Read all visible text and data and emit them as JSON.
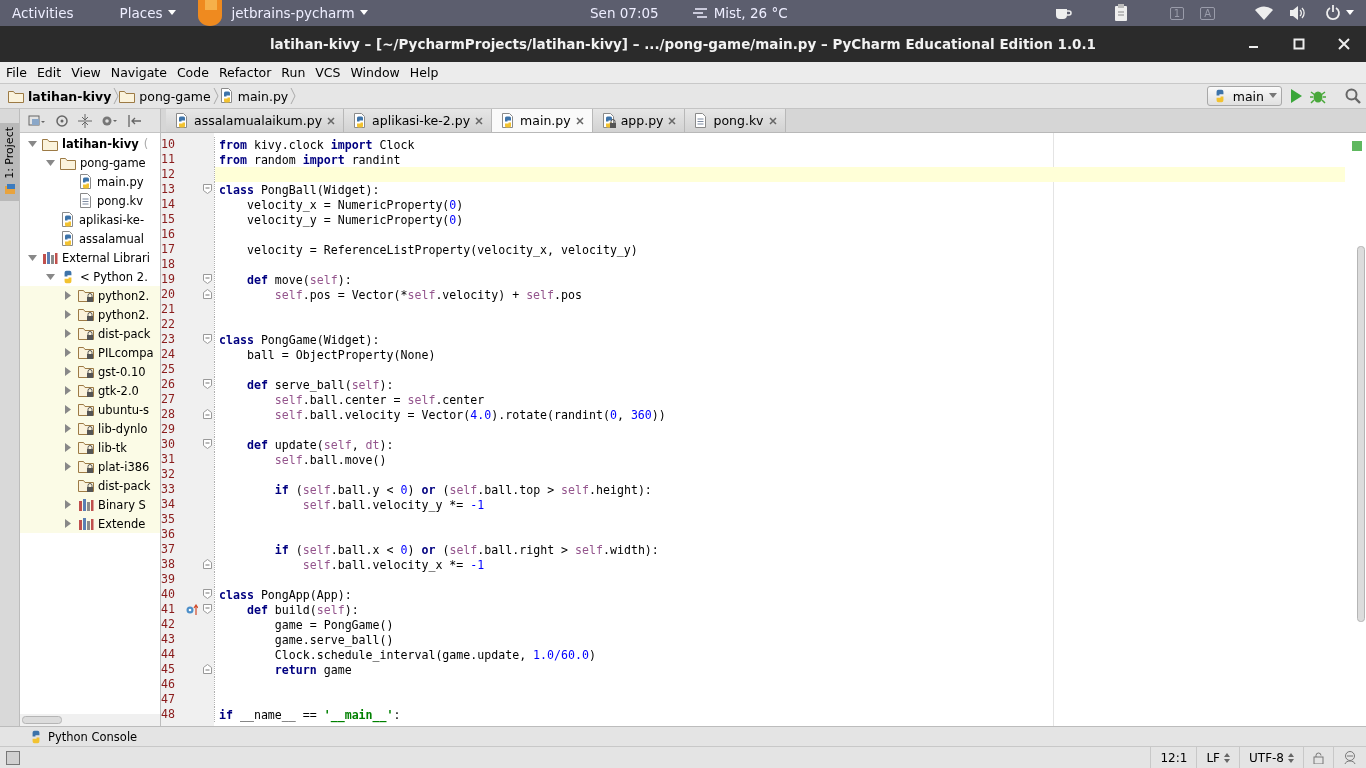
{
  "top_bar": {
    "activities": "Activities",
    "places": "Places",
    "app": "jetbrains-pycharm",
    "clock": "Sen 07:05",
    "weather": "Mist, 26 °C",
    "indicators": [
      "1",
      "A"
    ]
  },
  "window": {
    "title": "latihan-kivy – [~/PycharmProjects/latihan-kivy] – .../pong-game/main.py – PyCharm Educational Edition 1.0.1"
  },
  "menu": [
    "File",
    "Edit",
    "View",
    "Navigate",
    "Code",
    "Refactor",
    "Run",
    "VCS",
    "Window",
    "Help"
  ],
  "breadcrumbs": [
    {
      "label": "latihan-kivy",
      "kind": "project"
    },
    {
      "label": "pong-game",
      "kind": "folder"
    },
    {
      "label": "main.py",
      "kind": "python-file"
    }
  ],
  "run_config": {
    "label": "main"
  },
  "tool_window": {
    "label": "1: Project",
    "selected": true
  },
  "project_tree": [
    {
      "label": "latihan-kivy",
      "suffix": "(",
      "kind": "folder",
      "expanded": true,
      "highlighted": false,
      "children": [
        {
          "label": "pong-game",
          "kind": "folder",
          "expanded": true,
          "highlighted": false,
          "children": [
            {
              "label": "main.py",
              "kind": "python-file",
              "highlighted": false
            },
            {
              "label": "pong.kv",
              "kind": "text-file",
              "highlighted": false
            }
          ]
        },
        {
          "label": "aplikasi-ke-",
          "kind": "python-file",
          "highlighted": false
        },
        {
          "label": "assalamual",
          "kind": "python-file",
          "highlighted": false
        }
      ]
    },
    {
      "label": "External Librari",
      "kind": "library",
      "expanded": true,
      "highlighted": false,
      "children": [
        {
          "label": "< Python 2.",
          "kind": "python-sdk",
          "expanded": true,
          "highlighted": false,
          "children": [
            {
              "label": "python2.",
              "kind": "locked-folder",
              "expanded": false,
              "highlighted": true
            },
            {
              "label": "python2.",
              "kind": "locked-folder",
              "expanded": false,
              "highlighted": true
            },
            {
              "label": "dist-pack",
              "kind": "locked-folder",
              "expanded": false,
              "highlighted": true
            },
            {
              "label": "PILcompa",
              "kind": "locked-folder",
              "expanded": false,
              "highlighted": true
            },
            {
              "label": "gst-0.10",
              "kind": "locked-folder",
              "expanded": false,
              "highlighted": true
            },
            {
              "label": "gtk-2.0",
              "kind": "locked-folder",
              "expanded": false,
              "highlighted": true
            },
            {
              "label": "ubuntu-s",
              "kind": "locked-folder",
              "expanded": false,
              "highlighted": true
            },
            {
              "label": "lib-dynlo",
              "kind": "locked-folder",
              "expanded": false,
              "highlighted": true
            },
            {
              "label": "lib-tk",
              "kind": "locked-folder",
              "expanded": false,
              "highlighted": true
            },
            {
              "label": "plat-i386",
              "kind": "locked-folder",
              "expanded": false,
              "highlighted": true
            },
            {
              "label": "dist-pack",
              "kind": "locked-folder",
              "highlighted": true
            },
            {
              "label": "Binary S",
              "kind": "library",
              "expanded": false,
              "highlighted": true
            },
            {
              "label": "Extende",
              "kind": "library",
              "expanded": false,
              "highlighted": true
            }
          ]
        }
      ]
    }
  ],
  "editor_tabs": [
    {
      "label": "assalamualaikum.py",
      "kind": "python-file",
      "selected": false
    },
    {
      "label": "aplikasi-ke-2.py",
      "kind": "python-file",
      "selected": false
    },
    {
      "label": "main.py",
      "kind": "python-file",
      "selected": true
    },
    {
      "label": "app.py",
      "kind": "locked-python-file",
      "selected": false
    },
    {
      "label": "pong.kv",
      "kind": "text-file",
      "selected": false
    }
  ],
  "code": {
    "lines": [
      {
        "number": "10",
        "current": false,
        "tokens": [
          {
            "kind": "keyword",
            "text": "from"
          },
          {
            "kind": "plain",
            "text": " kivy.clock "
          },
          {
            "kind": "keyword",
            "text": "import"
          },
          {
            "kind": "plain",
            "text": " Clock"
          }
        ]
      },
      {
        "number": "11",
        "current": false,
        "tokens": [
          {
            "kind": "keyword",
            "text": "from"
          },
          {
            "kind": "plain",
            "text": " random "
          },
          {
            "kind": "keyword",
            "text": "import"
          },
          {
            "kind": "plain",
            "text": " randint"
          }
        ]
      },
      {
        "number": "12",
        "current": true
      },
      {
        "number": "13",
        "current": false,
        "kind": "opener",
        "tokens": [
          {
            "kind": "keyword",
            "text": "class"
          },
          {
            "kind": "plain",
            "text": " PongBall(Widget):"
          }
        ]
      },
      {
        "number": "14",
        "current": false,
        "tokens": [
          {
            "kind": "plain",
            "text": "    velocity_x = NumericProperty("
          },
          {
            "kind": "number",
            "text": "0"
          },
          {
            "kind": "plain",
            "text": ")"
          }
        ]
      },
      {
        "number": "15",
        "current": false,
        "tokens": [
          {
            "kind": "plain",
            "text": "    velocity_y = NumericProperty("
          },
          {
            "kind": "number",
            "text": "0"
          },
          {
            "kind": "plain",
            "text": ")"
          }
        ]
      },
      {
        "number": "16",
        "current": false
      },
      {
        "number": "17",
        "current": false,
        "tokens": [
          {
            "kind": "plain",
            "text": "    velocity = ReferenceListProperty(velocity_x, velocity_y)"
          }
        ]
      },
      {
        "number": "18",
        "current": false
      },
      {
        "number": "19",
        "current": false,
        "kind": "opener",
        "tokens": [
          {
            "kind": "keyword",
            "text": "    def"
          },
          {
            "kind": "plain",
            "text": " move("
          },
          {
            "kind": "self",
            "text": "self"
          },
          {
            "kind": "plain",
            "text": "):"
          }
        ]
      },
      {
        "number": "20",
        "current": false,
        "kind": "closer",
        "tokens": [
          {
            "kind": "self",
            "text": "        self"
          },
          {
            "kind": "plain",
            "text": ".pos = Vector(*"
          },
          {
            "kind": "self",
            "text": "self"
          },
          {
            "kind": "plain",
            "text": ".velocity) + "
          },
          {
            "kind": "self",
            "text": "self"
          },
          {
            "kind": "plain",
            "text": ".pos"
          }
        ]
      },
      {
        "number": "21",
        "current": false
      },
      {
        "number": "22",
        "current": false
      },
      {
        "number": "23",
        "current": false,
        "kind": "opener",
        "tokens": [
          {
            "kind": "keyword",
            "text": "class"
          },
          {
            "kind": "plain",
            "text": " PongGame(Widget):"
          }
        ]
      },
      {
        "number": "24",
        "current": false,
        "tokens": [
          {
            "kind": "plain",
            "text": "    ball = ObjectProperty(None)"
          }
        ]
      },
      {
        "number": "25",
        "current": false
      },
      {
        "number": "26",
        "current": false,
        "kind": "opener",
        "tokens": [
          {
            "kind": "keyword",
            "text": "    def"
          },
          {
            "kind": "plain",
            "text": " serve_ball("
          },
          {
            "kind": "self",
            "text": "self"
          },
          {
            "kind": "plain",
            "text": "):"
          }
        ]
      },
      {
        "number": "27",
        "current": false,
        "tokens": [
          {
            "kind": "self",
            "text": "        self"
          },
          {
            "kind": "plain",
            "text": ".ball.center = "
          },
          {
            "kind": "self",
            "text": "self"
          },
          {
            "kind": "plain",
            "text": ".center"
          }
        ]
      },
      {
        "number": "28",
        "current": false,
        "kind": "closer",
        "tokens": [
          {
            "kind": "self",
            "text": "        self"
          },
          {
            "kind": "plain",
            "text": ".ball.velocity = Vector("
          },
          {
            "kind": "number",
            "text": "4.0"
          },
          {
            "kind": "plain",
            "text": ").rotate(randint("
          },
          {
            "kind": "number",
            "text": "0"
          },
          {
            "kind": "plain",
            "text": ", "
          },
          {
            "kind": "number",
            "text": "360"
          },
          {
            "kind": "plain",
            "text": "))"
          }
        ]
      },
      {
        "number": "29",
        "current": false
      },
      {
        "number": "30",
        "current": false,
        "kind": "opener",
        "tokens": [
          {
            "kind": "keyword",
            "text": "    def"
          },
          {
            "kind": "plain",
            "text": " update("
          },
          {
            "kind": "self",
            "text": "self"
          },
          {
            "kind": "plain",
            "text": ", "
          },
          {
            "kind": "self",
            "text": "dt"
          },
          {
            "kind": "plain",
            "text": "):"
          }
        ]
      },
      {
        "number": "31",
        "current": false,
        "tokens": [
          {
            "kind": "self",
            "text": "        self"
          },
          {
            "kind": "plain",
            "text": ".ball.move()"
          }
        ]
      },
      {
        "number": "32",
        "current": false
      },
      {
        "number": "33",
        "current": false,
        "tokens": [
          {
            "kind": "keyword",
            "text": "        if"
          },
          {
            "kind": "plain",
            "text": " ("
          },
          {
            "kind": "self",
            "text": "self"
          },
          {
            "kind": "plain",
            "text": ".ball.y < "
          },
          {
            "kind": "number",
            "text": "0"
          },
          {
            "kind": "plain",
            "text": ") "
          },
          {
            "kind": "keyword",
            "text": "or"
          },
          {
            "kind": "plain",
            "text": " ("
          },
          {
            "kind": "self",
            "text": "self"
          },
          {
            "kind": "plain",
            "text": ".ball.top > "
          },
          {
            "kind": "self",
            "text": "self"
          },
          {
            "kind": "plain",
            "text": ".height):"
          }
        ]
      },
      {
        "number": "34",
        "current": false,
        "tokens": [
          {
            "kind": "self",
            "text": "            self"
          },
          {
            "kind": "plain",
            "text": ".ball.velocity_y *= "
          },
          {
            "kind": "number",
            "text": "-1"
          }
        ]
      },
      {
        "number": "35",
        "current": false
      },
      {
        "number": "36",
        "current": false
      },
      {
        "number": "37",
        "current": false,
        "tokens": [
          {
            "kind": "keyword",
            "text": "        if"
          },
          {
            "kind": "plain",
            "text": " ("
          },
          {
            "kind": "self",
            "text": "self"
          },
          {
            "kind": "plain",
            "text": ".ball.x < "
          },
          {
            "kind": "number",
            "text": "0"
          },
          {
            "kind": "plain",
            "text": ") "
          },
          {
            "kind": "keyword",
            "text": "or"
          },
          {
            "kind": "plain",
            "text": " ("
          },
          {
            "kind": "self",
            "text": "self"
          },
          {
            "kind": "plain",
            "text": ".ball.right > "
          },
          {
            "kind": "self",
            "text": "self"
          },
          {
            "kind": "plain",
            "text": ".width):"
          }
        ]
      },
      {
        "number": "38",
        "current": false,
        "kind": "closer",
        "tokens": [
          {
            "kind": "self",
            "text": "            self"
          },
          {
            "kind": "plain",
            "text": ".ball.velocity_x *= "
          },
          {
            "kind": "number",
            "text": "-1"
          }
        ]
      },
      {
        "number": "39",
        "current": false
      },
      {
        "number": "40",
        "current": false,
        "kind": "opener",
        "tokens": [
          {
            "kind": "keyword",
            "text": "class"
          },
          {
            "kind": "plain",
            "text": " PongApp(App):"
          }
        ]
      },
      {
        "number": "41",
        "current": false,
        "kind": "override",
        "tokens": [
          {
            "kind": "keyword",
            "text": "    def"
          },
          {
            "kind": "plain",
            "text": " build("
          },
          {
            "kind": "self",
            "text": "self"
          },
          {
            "kind": "plain",
            "text": "):"
          }
        ]
      },
      {
        "number": "42",
        "current": false,
        "tokens": [
          {
            "kind": "plain",
            "text": "        game = PongGame()"
          }
        ]
      },
      {
        "number": "43",
        "current": false,
        "tokens": [
          {
            "kind": "plain",
            "text": "        game.serve_ball()"
          }
        ]
      },
      {
        "number": "44",
        "current": false,
        "tokens": [
          {
            "kind": "plain",
            "text": "        Clock.schedule_interval(game.update, "
          },
          {
            "kind": "number",
            "text": "1.0/60.0"
          },
          {
            "kind": "plain",
            "text": ")"
          }
        ]
      },
      {
        "number": "45",
        "current": false,
        "kind": "closer",
        "tokens": [
          {
            "kind": "keyword",
            "text": "        return"
          },
          {
            "kind": "plain",
            "text": " game"
          }
        ]
      },
      {
        "number": "46",
        "current": false
      },
      {
        "number": "47",
        "current": false
      },
      {
        "number": "48",
        "current": false,
        "tokens": [
          {
            "kind": "keyword",
            "text": "if"
          },
          {
            "kind": "plain",
            "text": " __name__ == "
          },
          {
            "kind": "string",
            "text": "'__main__'"
          },
          {
            "kind": "plain",
            "text": ":"
          }
        ]
      }
    ]
  },
  "bottom_tool": {
    "label": "Python Console"
  },
  "status_bar": {
    "position": "12:1",
    "line_separator": "LF",
    "encoding": "UTF-8"
  }
}
